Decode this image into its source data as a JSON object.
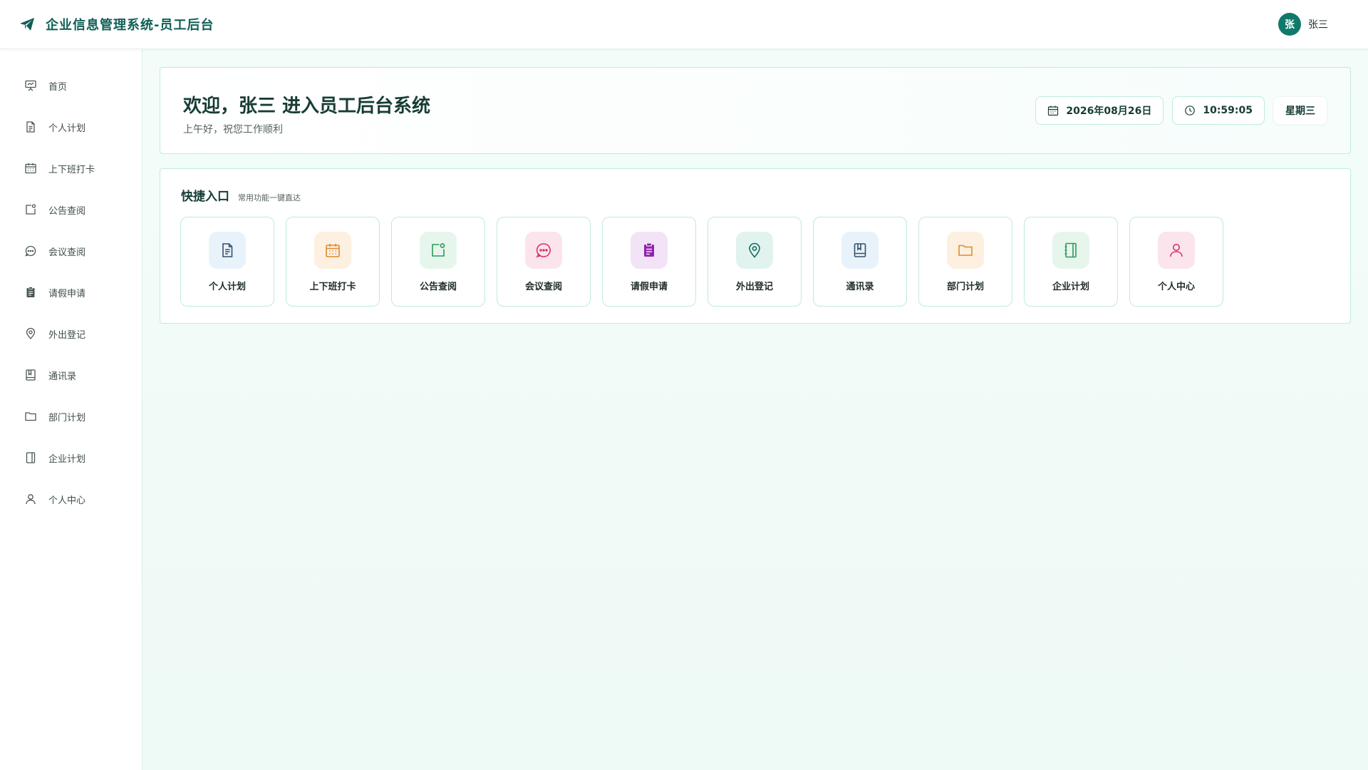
{
  "header": {
    "title": "企业信息管理系统-员工后台",
    "brand_icon": "paper-plane-icon",
    "user": {
      "avatar_text": "张",
      "name": "张三"
    }
  },
  "sidebar": {
    "items": [
      {
        "label": "首页",
        "icon": "presentation-icon"
      },
      {
        "label": "个人计划",
        "icon": "document-icon"
      },
      {
        "label": "上下班打卡",
        "icon": "calendar-icon"
      },
      {
        "label": "公告查阅",
        "icon": "notice-icon"
      },
      {
        "label": "会议查阅",
        "icon": "chat-icon"
      },
      {
        "label": "请假申请",
        "icon": "clipboard-icon"
      },
      {
        "label": "外出登记",
        "icon": "location-icon"
      },
      {
        "label": "通讯录",
        "icon": "contact-book-icon"
      },
      {
        "label": "部门计划",
        "icon": "folder-icon"
      },
      {
        "label": "企业计划",
        "icon": "notebook-icon"
      },
      {
        "label": "个人中心",
        "icon": "user-icon"
      }
    ]
  },
  "welcome": {
    "title": "欢迎，张三 进入员工后台系统",
    "subtitle": "上午好，祝您工作顺利",
    "date": "2026年08月26日",
    "time": "10:59:05",
    "weekday": "星期三"
  },
  "quick": {
    "title": "快捷入口",
    "subtitle": "常用功能一键直达",
    "tiles": [
      {
        "label": "个人计划",
        "icon": "document-icon",
        "color": "#35506b",
        "bg": "#e8f2fb"
      },
      {
        "label": "上下班打卡",
        "icon": "calendar-icon",
        "color": "#e0892c",
        "bg": "#fdf0e1"
      },
      {
        "label": "公告查阅",
        "icon": "notice-icon",
        "color": "#2a9a5c",
        "bg": "#e6f6ec"
      },
      {
        "label": "会议查阅",
        "icon": "chat-icon",
        "color": "#d6336c",
        "bg": "#fce4ec"
      },
      {
        "label": "请假申请",
        "icon": "clipboard-icon",
        "color": "#8e24aa",
        "bg": "#f3e3f7"
      },
      {
        "label": "外出登记",
        "icon": "location-icon",
        "color": "#136b61",
        "bg": "#e0f3ef"
      },
      {
        "label": "通讯录",
        "icon": "contact-book-icon",
        "color": "#35506b",
        "bg": "#e8f2fb"
      },
      {
        "label": "部门计划",
        "icon": "folder-icon",
        "color": "#e0892c",
        "bg": "#fdf0e1"
      },
      {
        "label": "企业计划",
        "icon": "notebook-icon",
        "color": "#2a9a5c",
        "bg": "#e6f6ec"
      },
      {
        "label": "个人中心",
        "icon": "user-icon",
        "color": "#d6336c",
        "bg": "#fce4ec"
      }
    ]
  },
  "colors": {
    "brand": "#0f5f56",
    "accent": "#10796b",
    "border": "#bfeadf",
    "main_bg": "#f0fbf7"
  }
}
